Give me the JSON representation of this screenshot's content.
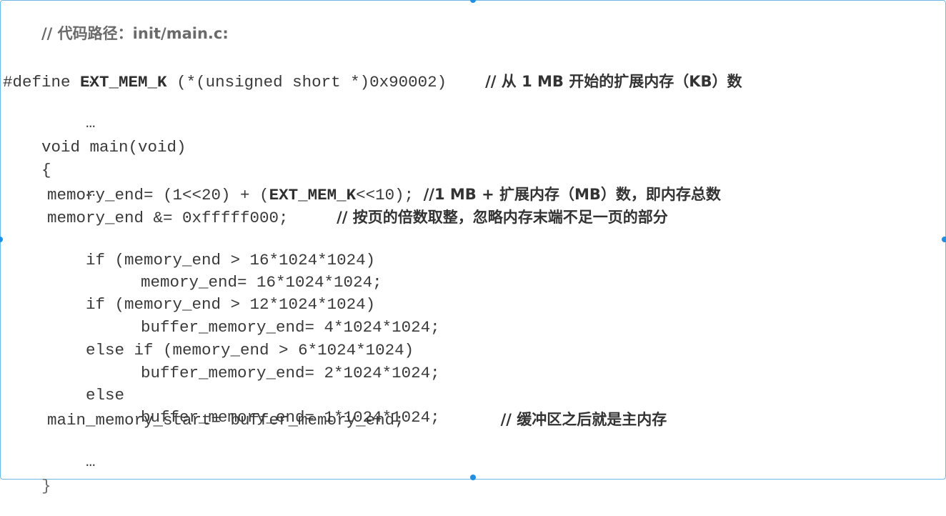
{
  "code": {
    "header": "// 代码路径：init/main.c:",
    "ellipsis": "…",
    "define_prefix": "#define ",
    "define_macro": "EXT_MEM_K",
    "define_value": " (*(unsigned short *)0x90002)    ",
    "define_comment": "// 从 1 MB 开始的扩展内存（KB）数",
    "main_decl": "void main(void)",
    "open_brace": "{",
    "mem_end_prefix": "memory_end= (1<<20) + (",
    "mem_end_macro": "EXT_MEM_K",
    "mem_end_suffix": "<<10); ",
    "mem_end_comment": "//1 MB + 扩展内存（MB）数，即内存总数",
    "mem_align_code": "memory_end &= 0xfffff000;     ",
    "mem_align_comment": "// 按页的倍数取整，忽略内存末端不足一页的部分",
    "if1": "if (memory_end > 16*1024*1024)",
    "if1_body": "memory_end= 16*1024*1024;",
    "if2": "if (memory_end > 12*1024*1024)",
    "if2_body": "buffer_memory_end= 4*1024*1024;",
    "elseif": "else if (memory_end > 6*1024*1024)",
    "elseif_body": "buffer_memory_end= 2*1024*1024;",
    "else": "else",
    "else_body": "buffer_memory_end= 1*1024*1024;",
    "main_start_code": "main_memory_start= buffer_memory_end;          ",
    "main_start_comment": "// 缓冲区之后就是主内存",
    "close_brace": "}"
  }
}
